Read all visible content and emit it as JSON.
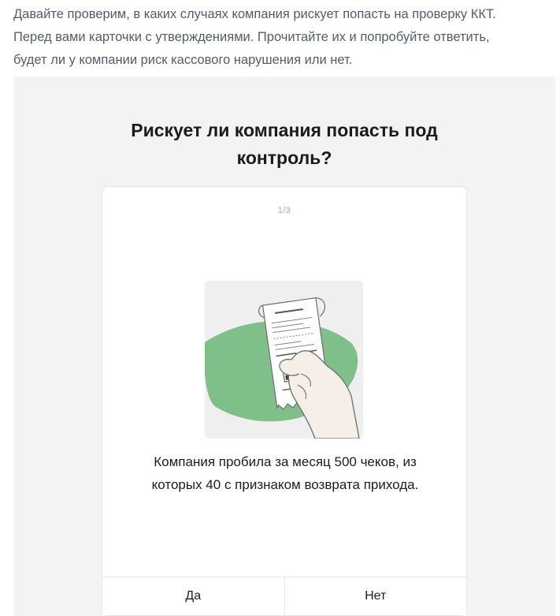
{
  "intro": {
    "line1": "Давайте проверим, в каких случаях компания рискует попасть на проверку ККТ.",
    "line2": "Перед вами карточки с утверждениями. Прочитайте их и попробуйте ответить,",
    "line3": "будет ли у компании риск кассового нарушения или нет."
  },
  "quiz": {
    "title_line1": "Рискует ли компания попасть под",
    "title_line2": "контроль?",
    "counter": "1/3",
    "statement_line1": "Компания пробила за месяц 500 чеков, из",
    "statement_line2": "которых 40 с признаком возврата прихода.",
    "answers": [
      {
        "label": "Да"
      },
      {
        "label": "Нет"
      }
    ]
  },
  "colors": {
    "panel_bg": "#f3f3f4",
    "illustration_green": "#7fc08a",
    "card_border": "#e6e6e9"
  },
  "icons": {
    "illustration": "receipt-in-hand-illustration"
  }
}
